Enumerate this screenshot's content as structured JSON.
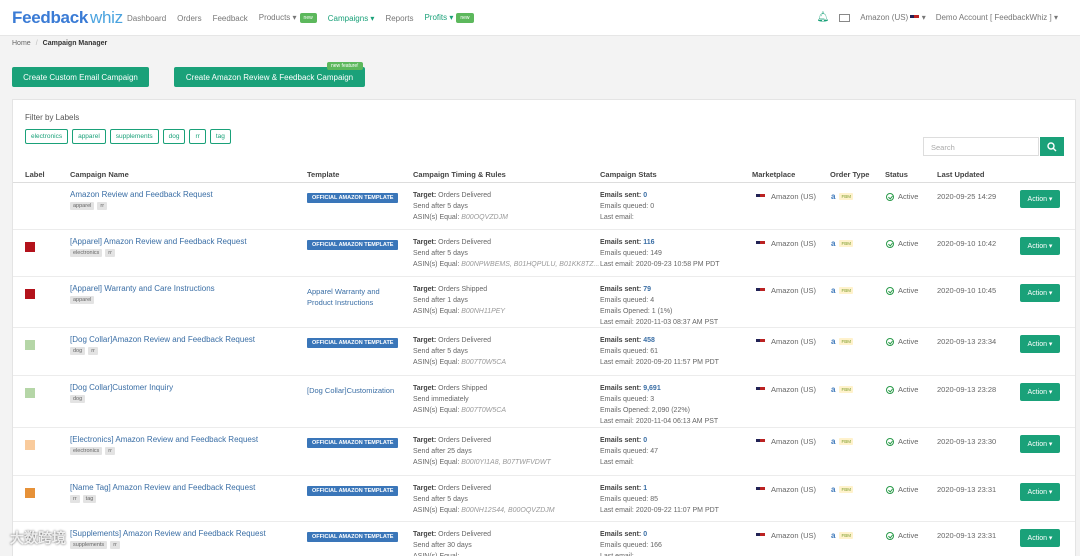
{
  "brand": {
    "name_bold": "Feedback",
    "name_light": "whiz"
  },
  "nav": {
    "items": [
      {
        "label": "Dashboard"
      },
      {
        "label": "Orders"
      },
      {
        "label": "Feedback"
      },
      {
        "label": "Products ▾",
        "badge": "new"
      },
      {
        "label": "Campaigns ▾"
      },
      {
        "label": "Reports"
      },
      {
        "label": "Profits ▾",
        "badge": "new"
      }
    ],
    "marketplace": "Amazon (US)",
    "account": "Demo Account  [ FeedbackWhiz ]  ▾"
  },
  "breadcrumb": {
    "home": "Home",
    "current": "Campaign Manager"
  },
  "buttons": {
    "custom": "Create Custom Email Campaign",
    "amazon": "Create Amazon Review & Feedback Campaign",
    "amazon_badge": "new feature!"
  },
  "filter": {
    "title": "Filter by Labels",
    "labels": [
      "electronics",
      "apparel",
      "supplements",
      "dog",
      "rr",
      "tag"
    ]
  },
  "search": {
    "placeholder": "Search"
  },
  "table": {
    "headers": {
      "label": "Label",
      "name": "Campaign Name",
      "template": "Template",
      "timing": "Campaign Timing & Rules",
      "stats": "Campaign Stats",
      "marketplace": "Marketplace",
      "order_type": "Order Type",
      "status": "Status",
      "updated": "Last Updated"
    },
    "rows": [
      {
        "color": "",
        "name": "Amazon Review and Feedback Request",
        "tags": [
          "apparel",
          "rr"
        ],
        "template": "OFFICIAL AMAZON TEMPLATE",
        "template_type": "official",
        "target": "Orders Delivered",
        "send": "Send after 5 days",
        "asin": "B00OQVZDJM",
        "stats": [
          {
            "label": "Emails sent:",
            "value": "0",
            "bold": true
          },
          {
            "label": "Emails queued:",
            "value": "0"
          },
          {
            "label": "Last email:",
            "value": ""
          }
        ],
        "marketplace": "Amazon (US)",
        "status": "Active",
        "updated": "2020-09-25 14:29",
        "action": "Action ▾"
      },
      {
        "color": "#b3121b",
        "name": "[Apparel] Amazon Review and Feedback Request",
        "tags": [
          "electronics",
          "rr"
        ],
        "template": "OFFICIAL AMAZON TEMPLATE",
        "template_type": "official",
        "target": "Orders Delivered",
        "send": "Send after 5 days",
        "asin": "B00NPWBEMS, B01HQPULU, B01KK8TZ...",
        "stats": [
          {
            "label": "Emails sent:",
            "value": "116",
            "bold": true
          },
          {
            "label": "Emails queued:",
            "value": "149"
          },
          {
            "label": "Last email:",
            "value": "2020-09-23 10:58 PM PDT"
          }
        ],
        "marketplace": "Amazon (US)",
        "status": "Active",
        "updated": "2020-09-10 10:42",
        "action": "Action ▾"
      },
      {
        "color": "#b3121b",
        "name": "[Apparel] Warranty and Care Instructions",
        "tags": [
          "apparel"
        ],
        "template": "Apparel Warranty and Product Instructions",
        "template_type": "link",
        "target": "Orders Shipped",
        "send": "Send after 1 days",
        "asin": "B00NH11PEY",
        "stats": [
          {
            "label": "Emails sent:",
            "value": "79",
            "bold": true
          },
          {
            "label": "Emails queued:",
            "value": "4"
          },
          {
            "label": "Emails Opened:",
            "value": "1 (1%)"
          },
          {
            "label": "Last email:",
            "value": "2020-11-03 08:37 AM PST"
          }
        ],
        "marketplace": "Amazon (US)",
        "status": "Active",
        "updated": "2020-09-10 10:45",
        "action": "Action ▾"
      },
      {
        "color": "#b5d6a7",
        "name": "[Dog Collar]Amazon Review and Feedback Request",
        "tags": [
          "dog",
          "rr"
        ],
        "template": "OFFICIAL AMAZON TEMPLATE",
        "template_type": "official",
        "target": "Orders Delivered",
        "send": "Send after 5 days",
        "asin": "B007T0W5CA",
        "stats": [
          {
            "label": "Emails sent:",
            "value": "458",
            "bold": true
          },
          {
            "label": "Emails queued:",
            "value": "61"
          },
          {
            "label": "Last email:",
            "value": "2020-09-20 11:57 PM PDT"
          }
        ],
        "marketplace": "Amazon (US)",
        "status": "Active",
        "updated": "2020-09-13 23:34",
        "action": "Action ▾"
      },
      {
        "color": "#b5d6a7",
        "name": "[Dog Collar]Customer Inquiry",
        "tags": [
          "dog"
        ],
        "template": "[Dog Collar]Customization",
        "template_type": "link",
        "target": "Orders Shipped",
        "send": "Send immediately",
        "asin": "B007T0W5CA",
        "stats": [
          {
            "label": "Emails sent:",
            "value": "9,691",
            "bold": true
          },
          {
            "label": "Emails queued:",
            "value": "3"
          },
          {
            "label": "Emails Opened:",
            "value": "2,090 (22%)"
          },
          {
            "label": "Last email:",
            "value": "2020-11-04 06:13 AM PST"
          }
        ],
        "marketplace": "Amazon (US)",
        "status": "Active",
        "updated": "2020-09-13 23:28",
        "action": "Action ▾"
      },
      {
        "color": "#f9cb9c",
        "name": "[Electronics] Amazon Review and Feedback Request",
        "tags": [
          "electronics",
          "rr"
        ],
        "template": "OFFICIAL AMAZON TEMPLATE",
        "template_type": "official",
        "target": "Orders Delivered",
        "send": "Send after 25 days",
        "asin": "B00I0YI1A8, B07TWFVDWT",
        "stats": [
          {
            "label": "Emails sent:",
            "value": "0",
            "bold": true
          },
          {
            "label": "Emails queued:",
            "value": "47"
          },
          {
            "label": "Last email:",
            "value": ""
          }
        ],
        "marketplace": "Amazon (US)",
        "status": "Active",
        "updated": "2020-09-13 23:30",
        "action": "Action ▾"
      },
      {
        "color": "#e69138",
        "name": "[Name Tag] Amazon Review and Feedback Request",
        "tags": [
          "rr",
          "tag"
        ],
        "template": "OFFICIAL AMAZON TEMPLATE",
        "template_type": "official",
        "target": "Orders Delivered",
        "send": "Send after 5 days",
        "asin": "B00NH12S44, B00OQVZDJM",
        "stats": [
          {
            "label": "Emails sent:",
            "value": "1",
            "bold": true
          },
          {
            "label": "Emails queued:",
            "value": "85"
          },
          {
            "label": "Last email:",
            "value": "2020-09-22 11:07 PM PDT"
          }
        ],
        "marketplace": "Amazon (US)",
        "status": "Active",
        "updated": "2020-09-13 23:31",
        "action": "Action ▾"
      },
      {
        "color": "",
        "name": "[Supplements] Amazon Review and Feedback Request",
        "tags": [
          "supplements",
          "rr"
        ],
        "template": "OFFICIAL AMAZON TEMPLATE",
        "template_type": "official",
        "target": "Orders Delivered",
        "send": "Send after 30 days",
        "asin": "",
        "stats": [
          {
            "label": "Emails sent:",
            "value": "0",
            "bold": true
          },
          {
            "label": "Emails queued:",
            "value": "166"
          },
          {
            "label": "Last email:",
            "value": ""
          }
        ],
        "marketplace": "Amazon (US)",
        "status": "Active",
        "updated": "2020-09-13 23:31",
        "action": "Action ▾"
      }
    ]
  },
  "labels_text": {
    "target": "Target:",
    "asin": "ASIN(s) Equal:",
    "order_chip": "FBM"
  },
  "watermark": "大数跨境",
  "colors": {
    "accent": "#1aa179",
    "link": "#3a6ea5",
    "official": "#3a76b9"
  }
}
